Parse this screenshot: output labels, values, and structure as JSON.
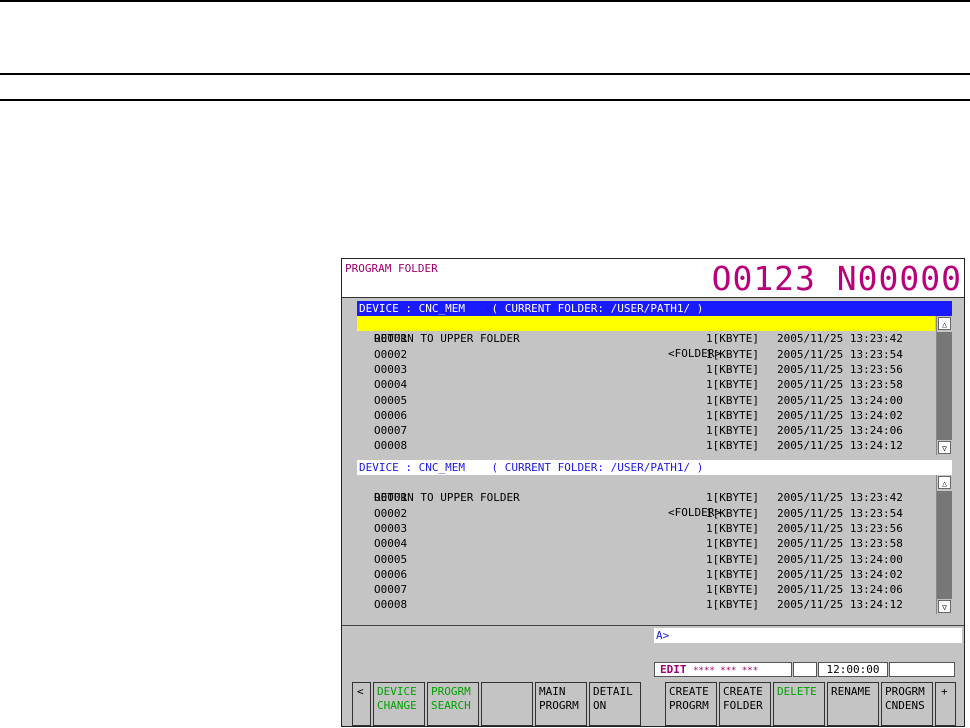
{
  "header": {
    "title": "PROGRAM FOLDER",
    "program_number": "O0123 N00000"
  },
  "upper_panel": {
    "device_line": "DEVICE : CNC_MEM    ( CURRENT FOLDER: /USER/PATH1/ )",
    "return_label": "RETURN TO UPPER FOLDER",
    "return_tag": "<FOLDER>",
    "files": [
      {
        "name": "O0001",
        "size": "1[KBYTE]",
        "date": "2005/11/25 13:23:42"
      },
      {
        "name": "O0002",
        "size": "1[KBYTE]",
        "date": "2005/11/25 13:23:54"
      },
      {
        "name": "O0003",
        "size": "1[KBYTE]",
        "date": "2005/11/25 13:23:56"
      },
      {
        "name": "O0004",
        "size": "1[KBYTE]",
        "date": "2005/11/25 13:23:58"
      },
      {
        "name": "O0005",
        "size": "1[KBYTE]",
        "date": "2005/11/25 13:24:00"
      },
      {
        "name": "O0006",
        "size": "1[KBYTE]",
        "date": "2005/11/25 13:24:02"
      },
      {
        "name": "O0007",
        "size": "1[KBYTE]",
        "date": "2005/11/25 13:24:06"
      },
      {
        "name": "O0008",
        "size": "1[KBYTE]",
        "date": "2005/11/25 13:24:12"
      }
    ]
  },
  "lower_panel": {
    "device_line": "DEVICE : CNC_MEM    ( CURRENT FOLDER: /USER/PATH1/ )",
    "return_label": "RETURN TO UPPER FOLDER",
    "return_tag": "<FOLDER>",
    "files": [
      {
        "name": "O0001",
        "size": "1[KBYTE]",
        "date": "2005/11/25 13:23:42"
      },
      {
        "name": "O0002",
        "size": "1[KBYTE]",
        "date": "2005/11/25 13:23:54"
      },
      {
        "name": "O0003",
        "size": "1[KBYTE]",
        "date": "2005/11/25 13:23:56"
      },
      {
        "name": "O0004",
        "size": "1[KBYTE]",
        "date": "2005/11/25 13:23:58"
      },
      {
        "name": "O0005",
        "size": "1[KBYTE]",
        "date": "2005/11/25 13:24:00"
      },
      {
        "name": "O0006",
        "size": "1[KBYTE]",
        "date": "2005/11/25 13:24:02"
      },
      {
        "name": "O0007",
        "size": "1[KBYTE]",
        "date": "2005/11/25 13:24:06"
      },
      {
        "name": "O0008",
        "size": "1[KBYTE]",
        "date": "2005/11/25 13:24:12"
      }
    ]
  },
  "input": {
    "prompt": "A>"
  },
  "status": {
    "mode": "EDIT",
    "stars": "**** *** ***",
    "time": "12:00:00"
  },
  "softkeys": {
    "left_arrow": "<",
    "device_change": [
      "DEVICE",
      "CHANGE"
    ],
    "progrm_search": [
      "PROGRM",
      "SEARCH"
    ],
    "main_progrm": [
      "MAIN",
      "PROGRM"
    ],
    "detail_on": [
      "DETAIL",
      "ON"
    ],
    "create_progrm": [
      "CREATE",
      "PROGRM"
    ],
    "create_folder": [
      "CREATE",
      "FOLDER"
    ],
    "delete": "DELETE",
    "rename": "RENAME",
    "progrm_cndens": [
      "PROGRM",
      "CNDENS"
    ],
    "plus": "+"
  },
  "colors": {
    "accent_magenta": "#b8007a",
    "active_blue": "#1a1aff",
    "selection_yellow": "#ffff00",
    "softkey_green": "#00a000"
  }
}
